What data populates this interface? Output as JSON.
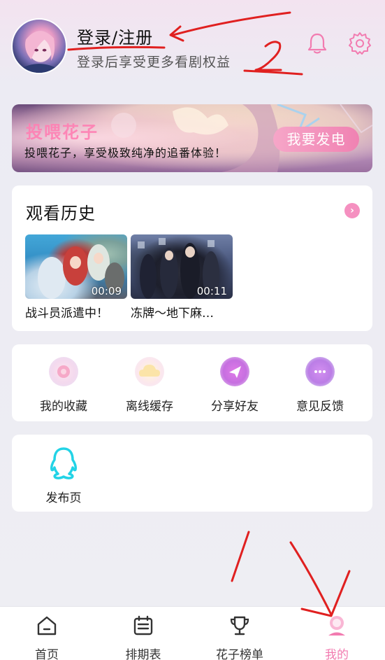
{
  "header": {
    "title": "登录/注册",
    "subtitle": "登录后享受更多看剧权益",
    "icons": [
      "bell-icon",
      "gear-icon"
    ]
  },
  "banner": {
    "title": "投喂花子",
    "subtitle": "投喂花子，享受极致纯净的追番体验！",
    "button": "我要发电"
  },
  "history": {
    "title": "观看历史",
    "items": [
      {
        "title": "战斗员派遣中！",
        "time": "00:09"
      },
      {
        "title": "冻牌～地下麻…",
        "time": "00:11"
      }
    ]
  },
  "actions": [
    {
      "label": "我的收藏",
      "icon": "favorites-icon"
    },
    {
      "label": "离线缓存",
      "icon": "cloud-cache-icon"
    },
    {
      "label": "分享好友",
      "icon": "share-icon"
    },
    {
      "label": "意见反馈",
      "icon": "feedback-icon"
    }
  ],
  "publish": {
    "label": "发布页",
    "icon": "qq-penguin-icon"
  },
  "nav": [
    {
      "label": "首页",
      "icon": "home-icon"
    },
    {
      "label": "排期表",
      "icon": "schedule-icon"
    },
    {
      "label": "花子榜单",
      "icon": "trophy-icon"
    },
    {
      "label": "我的",
      "icon": "profile-icon",
      "active": true
    }
  ],
  "colors": {
    "accent": "#f27bb0",
    "annotation": "#e02020",
    "qq_icon": "#22d3e6"
  }
}
